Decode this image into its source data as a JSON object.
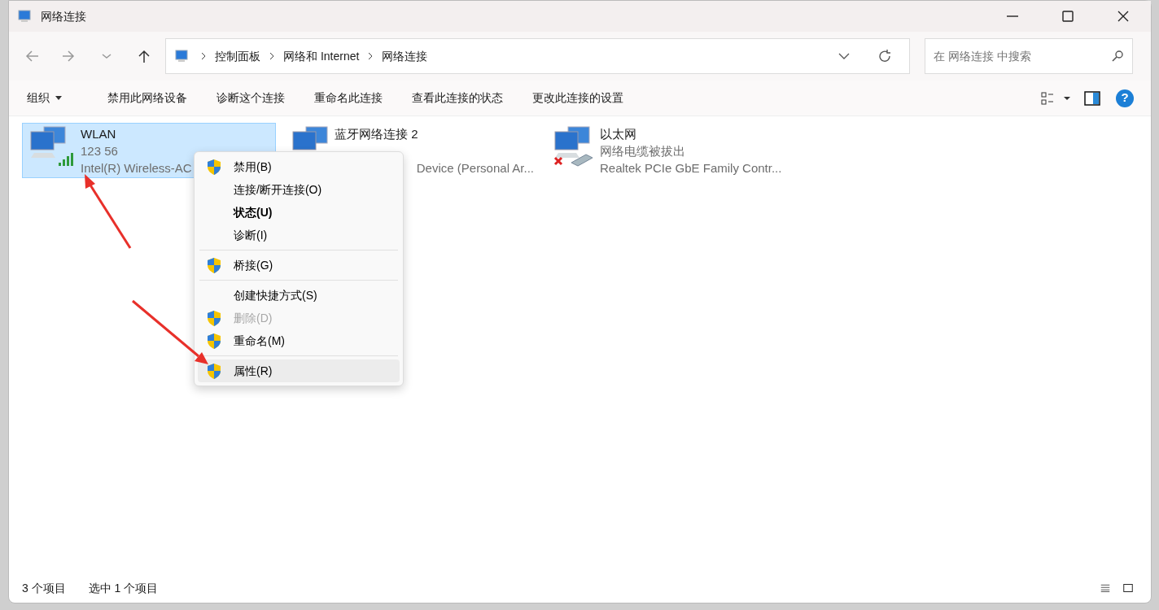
{
  "window": {
    "title": "网络连接"
  },
  "address_bar": {
    "breadcrumbs": [
      "控制面板",
      "网络和 Internet",
      "网络连接"
    ]
  },
  "search": {
    "placeholder": "在 网络连接 中搜索"
  },
  "toolbar": {
    "organize": "组织",
    "commands": [
      "禁用此网络设备",
      "诊断这个连接",
      "重命名此连接",
      "查看此连接的状态",
      "更改此连接的设置"
    ]
  },
  "connections": [
    {
      "kind": "wifi",
      "name": "WLAN",
      "status": "123 56",
      "device": "Intel(R) Wireless-AC",
      "selected": true
    },
    {
      "kind": "bluetooth",
      "name": "蓝牙网络连接 2",
      "device": "Device (Personal Ar...",
      "selected": false
    },
    {
      "kind": "ethernet",
      "name": "以太网",
      "status": "网络电缆被拔出",
      "device": "Realtek PCIe GbE Family Contr...",
      "selected": false
    }
  ],
  "context_menu": {
    "sections": [
      [
        {
          "label": "禁用(B)",
          "shield": true,
          "bold": false,
          "disabled": false,
          "selected": false
        },
        {
          "label": "连接/断开连接(O)",
          "shield": false,
          "bold": false,
          "disabled": false,
          "selected": false
        },
        {
          "label": "状态(U)",
          "shield": false,
          "bold": true,
          "disabled": false,
          "selected": false
        },
        {
          "label": "诊断(I)",
          "shield": false,
          "bold": false,
          "disabled": false,
          "selected": false
        }
      ],
      [
        {
          "label": "桥接(G)",
          "shield": true,
          "bold": false,
          "disabled": false,
          "selected": false
        }
      ],
      [
        {
          "label": "创建快捷方式(S)",
          "shield": false,
          "bold": false,
          "disabled": false,
          "selected": false
        },
        {
          "label": "删除(D)",
          "shield": true,
          "bold": false,
          "disabled": true,
          "selected": false
        },
        {
          "label": "重命名(M)",
          "shield": true,
          "bold": false,
          "disabled": false,
          "selected": false
        }
      ],
      [
        {
          "label": "属性(R)",
          "shield": true,
          "bold": false,
          "disabled": false,
          "selected": true
        }
      ]
    ]
  },
  "help_button": "?",
  "status_bar": {
    "item_count": "3 个项目",
    "selection": "选中 1 个项目"
  }
}
